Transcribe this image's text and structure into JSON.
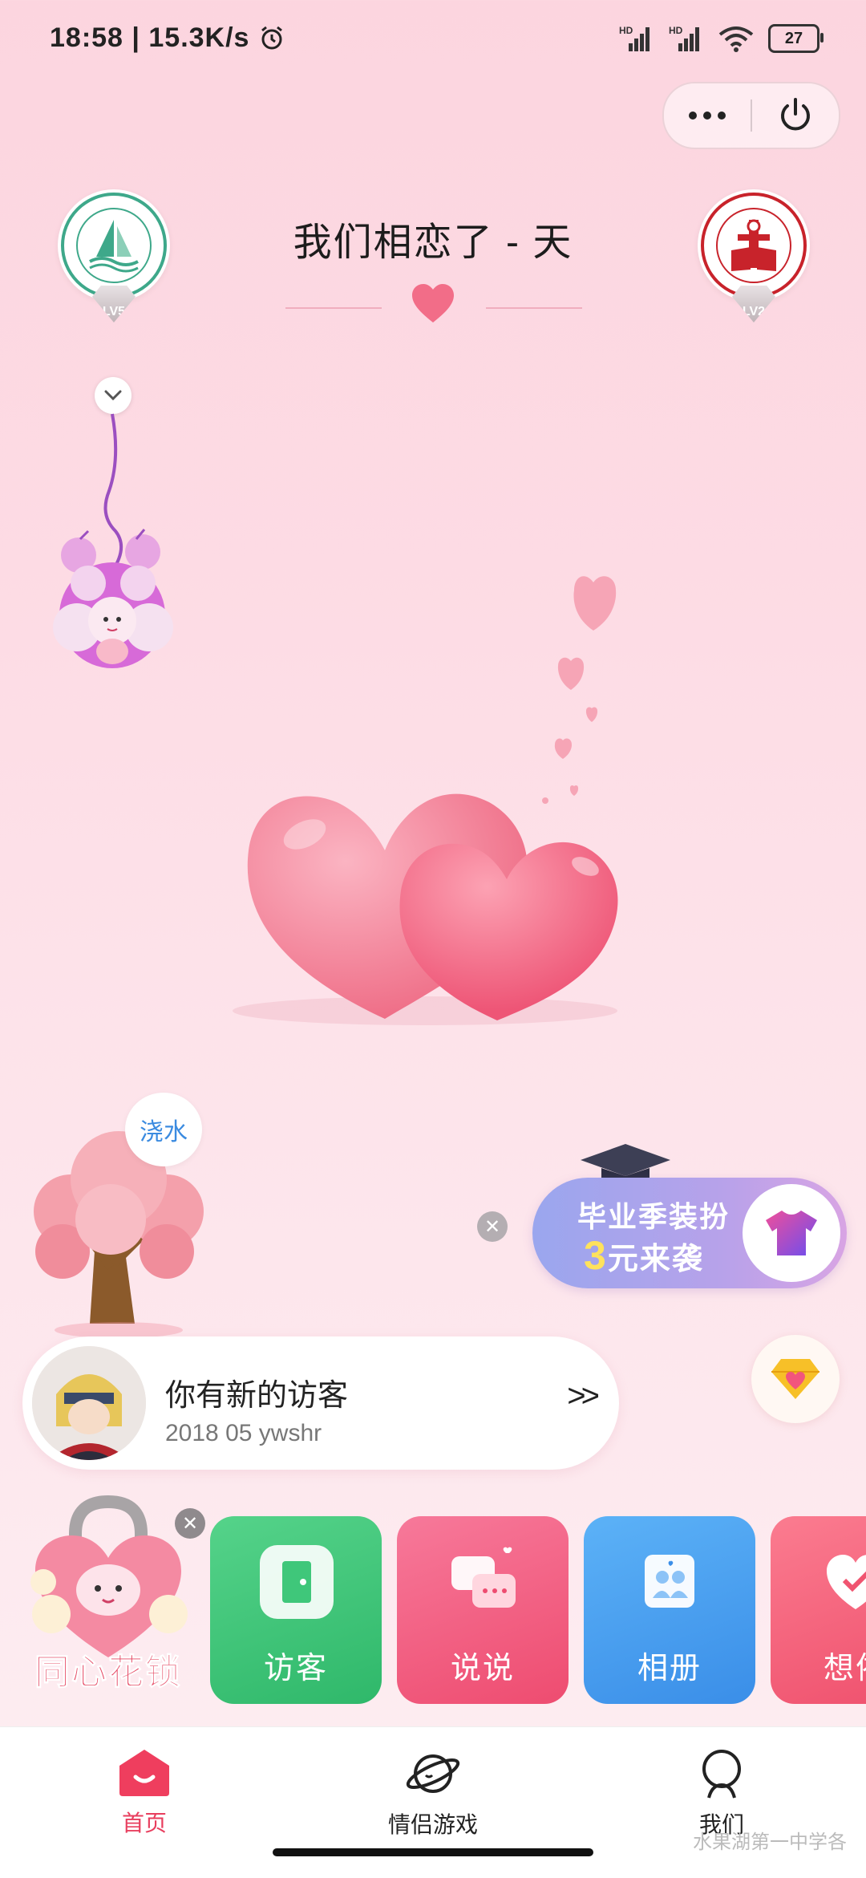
{
  "status_bar": {
    "time": "18:58",
    "network_speed": "15.3K/s",
    "sim1": "HD",
    "sim2": "HD",
    "battery": "27"
  },
  "header": {
    "title": "我们相恋了 - 天",
    "left_level": "LV5",
    "right_level": "LV2"
  },
  "watering": {
    "label": "浇水"
  },
  "promo": {
    "line1": "毕业季装扮",
    "price_num": "3",
    "price_text": "元来袭"
  },
  "visitor_card": {
    "title": "你有新的访客",
    "subtitle": "2018 05 ywshr",
    "arrow": ">>"
  },
  "feature_tiles": [
    {
      "label": "同心花锁"
    },
    {
      "label": "访客",
      "color": "#3fc77a"
    },
    {
      "label": "说说",
      "color": "#f2607f"
    },
    {
      "label": "相册",
      "color": "#4aa0f0"
    },
    {
      "label": "想依",
      "color": "#f56a83"
    }
  ],
  "bottom_nav": [
    {
      "label": "首页",
      "active": true
    },
    {
      "label": "情侣游戏",
      "active": false
    },
    {
      "label": "我们",
      "active": false
    }
  ],
  "watermark": "水果湖第一中学各",
  "colors": {
    "accent": "#e83e5e",
    "background": "#fcd5df"
  }
}
